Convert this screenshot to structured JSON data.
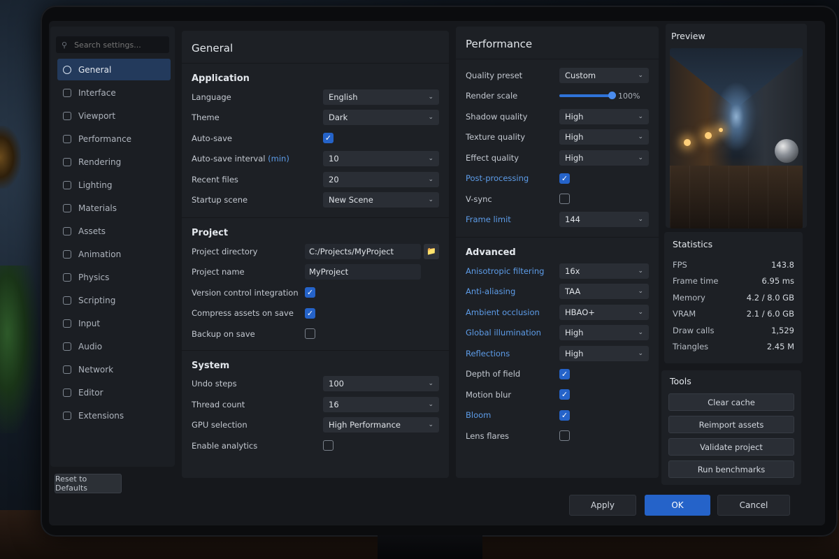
{
  "sidebar": {
    "search_placeholder": "Search settings...",
    "items": [
      {
        "label": "General",
        "icon": "gear-icon",
        "active": true
      },
      {
        "label": "Interface",
        "icon": "interface-icon"
      },
      {
        "label": "Viewport",
        "icon": "viewport-icon"
      },
      {
        "label": "Performance",
        "icon": "performance-icon"
      },
      {
        "label": "Rendering",
        "icon": "rendering-icon"
      },
      {
        "label": "Lighting",
        "icon": "lighting-icon"
      },
      {
        "label": "Materials",
        "icon": "materials-icon"
      },
      {
        "label": "Assets",
        "icon": "assets-icon"
      },
      {
        "label": "Animation",
        "icon": "animation-icon"
      },
      {
        "label": "Physics",
        "icon": "physics-icon"
      },
      {
        "label": "Scripting",
        "icon": "scripting-icon"
      },
      {
        "label": "Input",
        "icon": "input-icon"
      },
      {
        "label": "Audio",
        "icon": "audio-icon"
      },
      {
        "label": "Network",
        "icon": "network-icon"
      },
      {
        "label": "Editor",
        "icon": "editor-icon"
      },
      {
        "label": "Extensions",
        "icon": "extensions-icon"
      }
    ],
    "reset_label": "Reset to Defaults"
  },
  "general": {
    "title": "General",
    "application": {
      "title": "Application",
      "language_label": "Language",
      "language_value": "English",
      "theme_label": "Theme",
      "theme_value": "Dark",
      "autosave_label": "Auto-save",
      "autosave_checked": true,
      "autosave_interval_label": "Auto-save interval",
      "autosave_interval_unit": "(min)",
      "autosave_interval_value": "10",
      "recent_files_label": "Recent files",
      "recent_files_value": "20",
      "startup_scene_label": "Startup scene",
      "startup_scene_value": "New Scene"
    },
    "project": {
      "title": "Project",
      "directory_label": "Project directory",
      "directory_value": "C:/Projects/MyProject",
      "name_label": "Project name",
      "name_value": "MyProject",
      "vcs_label": "Version control integration",
      "vcs_checked": true,
      "compress_label": "Compress assets on save",
      "compress_checked": true,
      "backup_label": "Backup on save",
      "backup_checked": false
    },
    "system": {
      "title": "System",
      "undo_label": "Undo steps",
      "undo_value": "100",
      "thread_label": "Thread count",
      "thread_value": "16",
      "gpu_label": "GPU selection",
      "gpu_value": "High Performance",
      "analytics_label": "Enable analytics",
      "analytics_checked": false
    }
  },
  "performance": {
    "title": "Performance",
    "quality_preset_label": "Quality preset",
    "quality_preset_value": "Custom",
    "render_scale_label": "Render scale",
    "render_scale_value": "100%",
    "render_scale_fraction": 1.0,
    "shadow_label": "Shadow quality",
    "shadow_value": "High",
    "texture_label": "Texture quality",
    "texture_value": "High",
    "effect_label": "Effect quality",
    "effect_value": "High",
    "postproc_label": "Post-processing",
    "postproc_checked": true,
    "vsync_label": "V-sync",
    "vsync_checked": false,
    "frame_limit_label": "Frame limit",
    "frame_limit_value": "144",
    "advanced": {
      "title": "Advanced",
      "aniso_label": "Anisotropic filtering",
      "aniso_value": "16x",
      "aa_label": "Anti-aliasing",
      "aa_value": "TAA",
      "ao_label": "Ambient occlusion",
      "ao_value": "HBAO+",
      "gi_label": "Global illumination",
      "gi_value": "High",
      "refl_label": "Reflections",
      "refl_value": "High",
      "dof_label": "Depth of field",
      "dof_checked": true,
      "motion_label": "Motion blur",
      "motion_checked": true,
      "bloom_label": "Bloom",
      "bloom_checked": true,
      "lens_label": "Lens flares",
      "lens_checked": false
    }
  },
  "preview": {
    "title": "Preview"
  },
  "statistics": {
    "title": "Statistics",
    "rows": [
      {
        "label": "FPS",
        "value": "143.8"
      },
      {
        "label": "Frame time",
        "value": "6.95 ms"
      },
      {
        "label": "Memory",
        "value": "4.2 / 8.0 GB"
      },
      {
        "label": "VRAM",
        "value": "2.1 / 6.0 GB"
      },
      {
        "label": "Draw calls",
        "value": "1,529"
      },
      {
        "label": "Triangles",
        "value": "2.45 M"
      }
    ]
  },
  "tools": {
    "title": "Tools",
    "buttons": [
      "Clear cache",
      "Reimport assets",
      "Validate project",
      "Run benchmarks"
    ]
  },
  "footer": {
    "apply": "Apply",
    "ok": "OK",
    "cancel": "Cancel"
  },
  "colors": {
    "accent": "#2563c9",
    "link_label": "#5d9ce8",
    "active_nav": "#233a5c"
  }
}
